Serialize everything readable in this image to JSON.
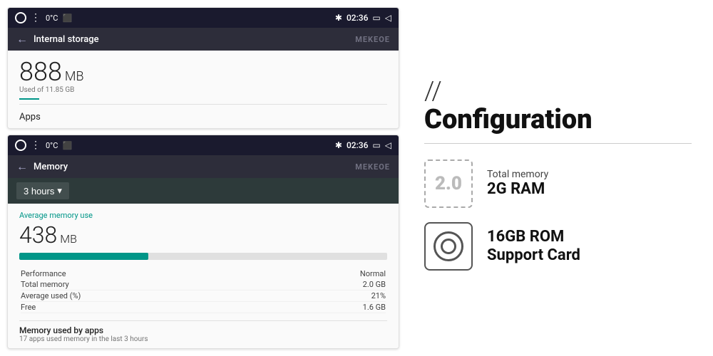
{
  "left": {
    "screen_top": {
      "status_bar": {
        "temp": "0°C",
        "time": "02:36",
        "watermark": "MEKEOE"
      },
      "nav": {
        "back_icon": "←",
        "title": "Internal storage"
      },
      "storage": {
        "number": "888",
        "unit": "MB",
        "used_label": "Used of 11.85 GB",
        "divider_color": "#009688",
        "apps_label": "Apps"
      }
    },
    "screen_bottom": {
      "status_bar": {
        "temp": "0°C",
        "time": "02:36",
        "watermark": "MEKEOE"
      },
      "nav": {
        "back_icon": "←",
        "title": "Memory"
      },
      "time_filter": {
        "label": "3 hours",
        "dropdown_icon": "▾"
      },
      "memory": {
        "avg_label": "Average memory use",
        "number": "438",
        "unit": "MB",
        "bar_fill_percent": 35,
        "stats": [
          {
            "label": "Performance",
            "value": "Normal"
          },
          {
            "label": "Total memory",
            "value": "2.0 GB"
          },
          {
            "label": "Average used (%)",
            "value": "21%"
          },
          {
            "label": "Free",
            "value": "1.6 GB"
          }
        ],
        "apps_section": {
          "title": "Memory used by apps",
          "subtitle": "17 apps used memory in the last 3 hours"
        }
      }
    }
  },
  "right": {
    "slash": "//",
    "title": "Configuration",
    "items": [
      {
        "icon_type": "text",
        "icon_value": "2.0",
        "spec_label": "Total memory",
        "spec_value": "2G RAM"
      },
      {
        "icon_type": "camera",
        "spec_label": "16GB ROM",
        "spec_value": "Support Card"
      }
    ]
  }
}
